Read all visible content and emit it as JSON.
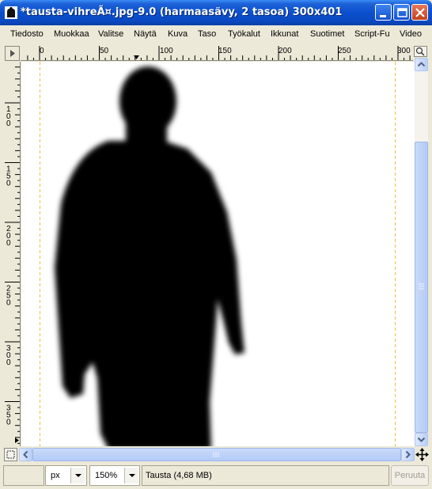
{
  "window": {
    "title": "*tausta-vihreÃ¤.jpg-9.0 (harmaasävy, 2 tasoa) 300x401",
    "titlebar_color": "#0a4fce",
    "controls": [
      "minimize-icon",
      "maximize-icon",
      "close-icon"
    ]
  },
  "menu": {
    "items": [
      {
        "label": "Tiedosto"
      },
      {
        "label": "Muokkaa"
      },
      {
        "label": "Valitse"
      },
      {
        "label": "Näytä"
      },
      {
        "label": "Kuva"
      },
      {
        "label": "Taso"
      },
      {
        "label": "Työkalut"
      },
      {
        "label": "Ikkunat"
      },
      {
        "label": "Suotimet"
      },
      {
        "label": "Script-Fu"
      },
      {
        "label": "Video"
      }
    ]
  },
  "rulers": {
    "horizontal_labels": [
      "0",
      "50",
      "100",
      "150",
      "200",
      "250",
      "300"
    ],
    "vertical_labels": [
      "100",
      "150",
      "200",
      "250",
      "300",
      "350"
    ]
  },
  "canvas": {
    "background": "#ffffff",
    "content": "silhouette-image"
  },
  "statusbar": {
    "unit": "px",
    "zoom": "150%",
    "layer_info": "Tausta (4,68 MB)",
    "cancel_label": "Peruuta"
  }
}
